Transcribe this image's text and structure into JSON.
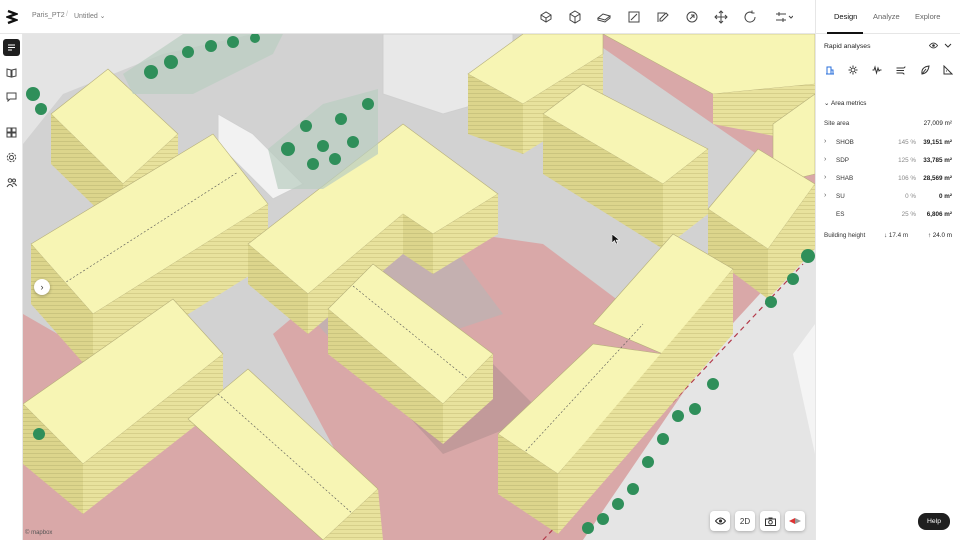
{
  "header": {
    "project_name": "Paris_PT2",
    "file_name": "Untitled",
    "tabs": [
      {
        "label": "Design",
        "active": true
      },
      {
        "label": "Analyze",
        "active": false
      },
      {
        "label": "Explore",
        "active": false
      }
    ],
    "tools": [
      "box-icon",
      "cube-icon",
      "extrude-icon",
      "area-icon",
      "edit-icon",
      "rotate-icon",
      "move-icon",
      "refresh-icon",
      "sliders-icon"
    ]
  },
  "sidebar": {
    "items": [
      {
        "icon": "layers-icon",
        "active": true
      },
      {
        "icon": "book-icon",
        "active": false
      },
      {
        "icon": "comment-icon",
        "active": false
      },
      {
        "icon": "grid-icon",
        "active": false
      },
      {
        "icon": "settings-icon",
        "active": false
      },
      {
        "icon": "users-icon",
        "active": false
      }
    ]
  },
  "map": {
    "view_mode_label": "2D",
    "attribution": "© mapbox"
  },
  "panel": {
    "title": "Rapid analyses",
    "section_title": "Area metrics",
    "site_area": {
      "label": "Site area",
      "value": "27,009 m²"
    },
    "metrics": [
      {
        "label": "SHOB",
        "pct": "145 %",
        "value": "39,151 m²",
        "expandable": true
      },
      {
        "label": "SDP",
        "pct": "125 %",
        "value": "33,785 m²",
        "expandable": true
      },
      {
        "label": "SHAB",
        "pct": "106 %",
        "value": "28,569 m²",
        "expandable": true
      },
      {
        "label": "SU",
        "pct": "0 %",
        "value": "0 m²",
        "expandable": true
      },
      {
        "label": "ES",
        "pct": "25 %",
        "value": "6,806 m²",
        "expandable": false
      }
    ],
    "building_height": {
      "label": "Building height",
      "min": "17.4 m",
      "max": "24.0 m"
    },
    "help_label": "Help"
  },
  "colors": {
    "building_top": "#f7f5b4",
    "building_side": "#ddd690",
    "plot": "#d9a8a8",
    "ground": "#cfcfcf",
    "tree": "#2f8f5a"
  }
}
